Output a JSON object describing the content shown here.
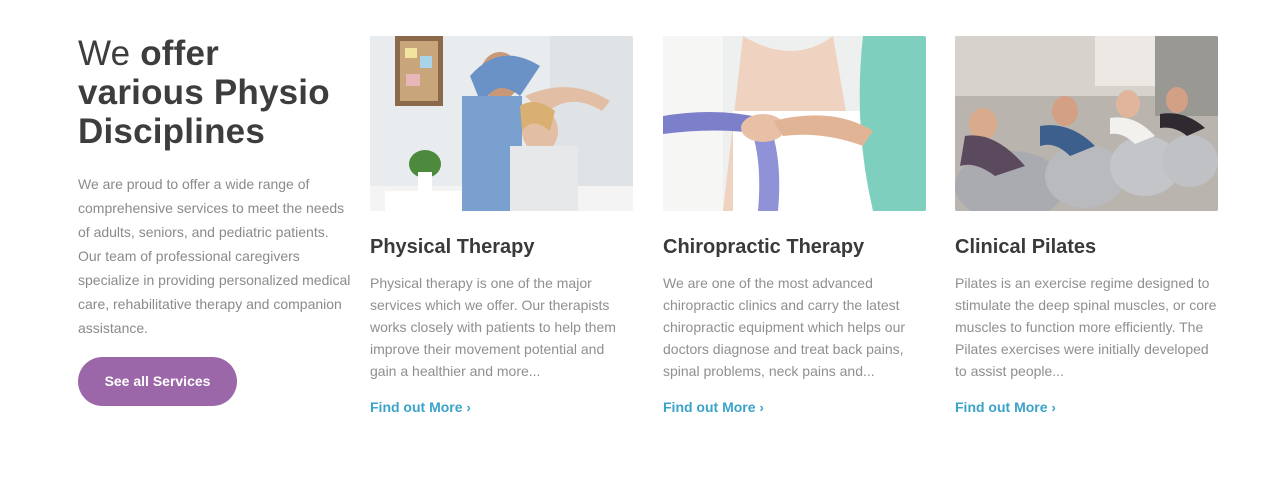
{
  "intro": {
    "title_plain": "We ",
    "title_bold": "offer various Physio Disciplines",
    "description": "We are proud to offer a wide range of comprehensive services to meet the needs of adults, seniors, and pediatric patients. Our team of professional caregivers specialize in providing personalized medical care, rehabilitative therapy and companion assistance.",
    "button_label": "See all Services"
  },
  "services": [
    {
      "title": "Physical Therapy",
      "description": "Physical therapy is one of the major services which we offer. Our therapists works closely with patients to help them improve their movement potential and gain a healthier and more...",
      "link_label": "Find out More",
      "link_icon": "chevron-right-icon"
    },
    {
      "title": "Chiropractic Therapy",
      "description": "We are one of the most advanced chiropractic clinics and carry the latest chiropractic equipment which helps our doctors diagnose and treat back pains, spinal problems, neck pains and...",
      "link_label": "Find out More",
      "link_icon": "chevron-right-icon"
    },
    {
      "title": "Clinical Pilates",
      "description": "Pilates is an exercise regime designed to stimulate the deep spinal muscles, or core muscles to function more efficiently. The Pilates exercises were initially developed to assist people...",
      "link_label": "Find out More",
      "link_icon": "chevron-right-icon"
    }
  ],
  "colors": {
    "heading": "#3d3d3d",
    "body_text": "#8a8a8a",
    "button_bg": "#9b67a8",
    "link": "#3aa3c9"
  }
}
